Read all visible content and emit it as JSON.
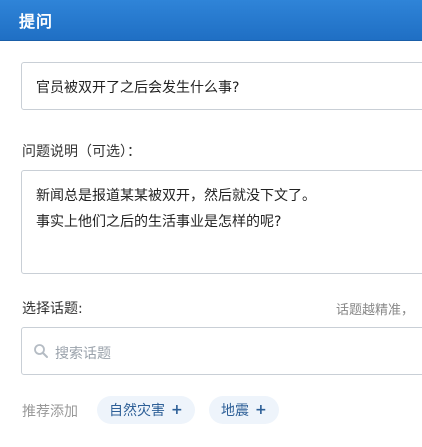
{
  "header": {
    "title": "提问"
  },
  "question": {
    "value": "官员被双开了之后会发生什么事?"
  },
  "description": {
    "label": "问题说明（可选）：",
    "lines": [
      "新闻总是报道某某被双开，然后就没下文了。",
      "事实上他们之后的生活事业是怎样的呢?"
    ]
  },
  "topics": {
    "label": "选择话题:",
    "hint": "话题越精准，",
    "search_placeholder": "搜索话题",
    "recommend_label": "推荐添加",
    "recommended": [
      {
        "label": "自然灾害",
        "action": "+"
      },
      {
        "label": "地震",
        "action": "+"
      }
    ]
  },
  "colors": {
    "header_blue": "#2a7dd2",
    "chip_bg": "#eef4fb",
    "chip_text": "#2d5f97"
  },
  "icons": {
    "search": "search-icon"
  }
}
